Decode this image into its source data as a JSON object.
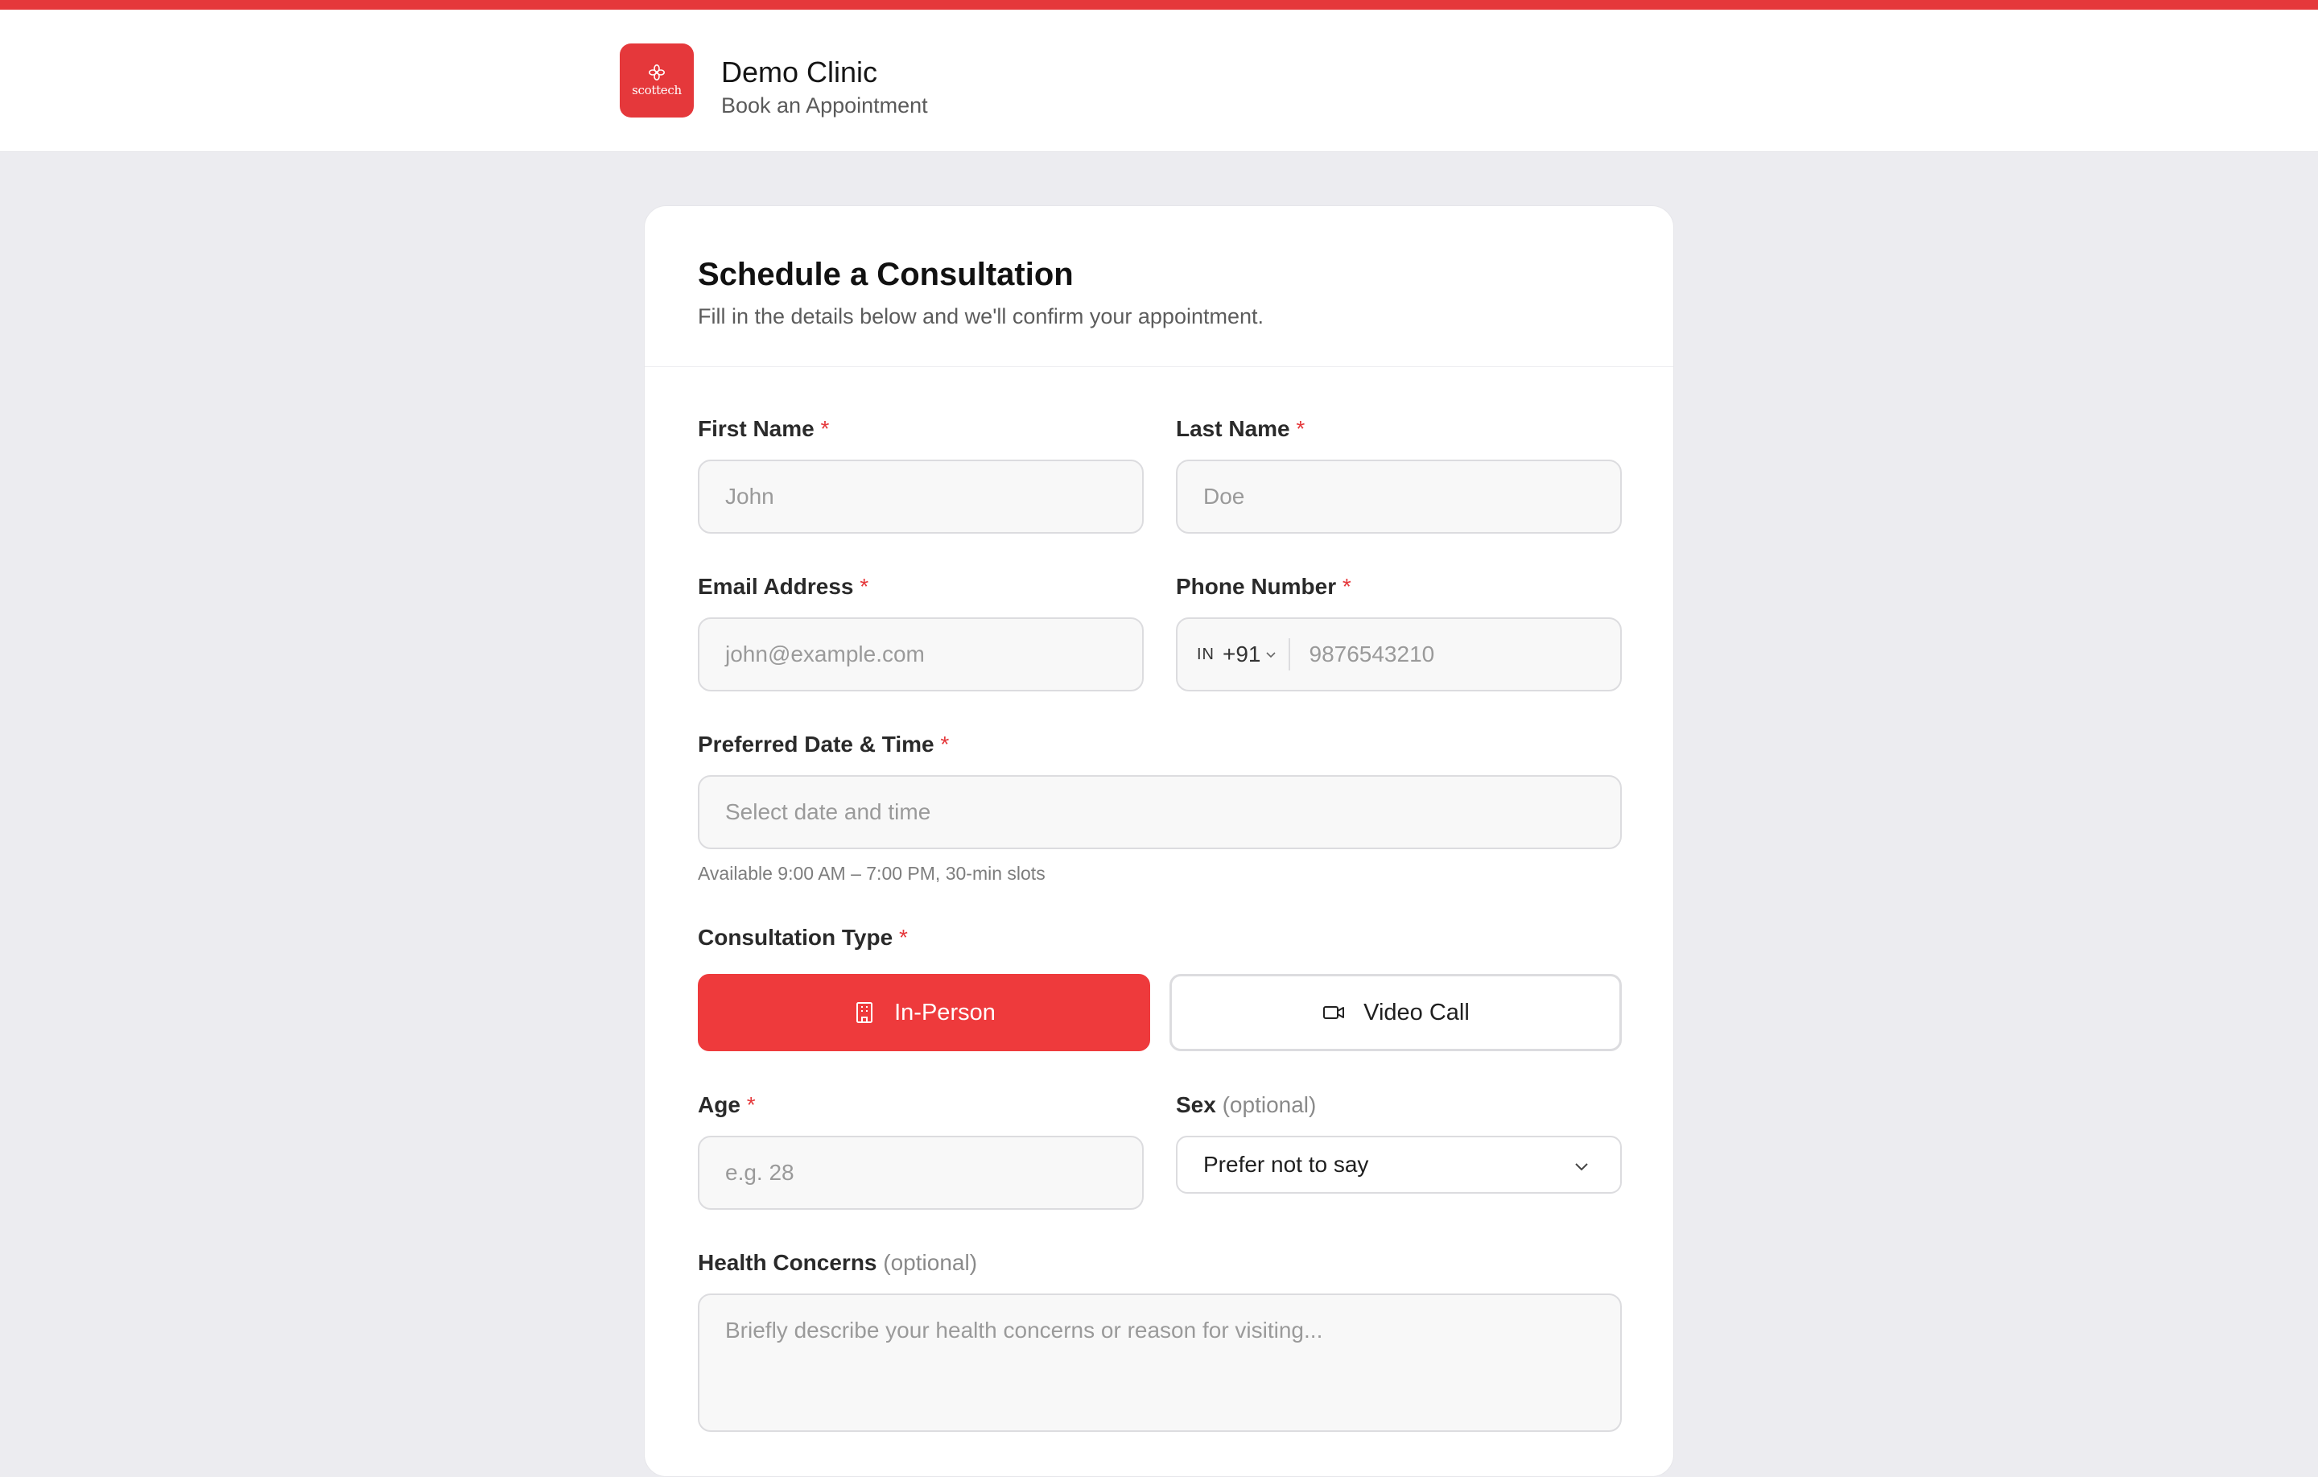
{
  "colors": {
    "accent": "#e5383b",
    "page_bg": "#ececf0"
  },
  "header": {
    "logo_text": "scottech",
    "clinic_name": "Demo Clinic",
    "subtitle": "Book an Appointment"
  },
  "form": {
    "title": "Schedule a Consultation",
    "description": "Fill in the details below and we'll confirm your appointment.",
    "required_marker": "*",
    "first_name": {
      "label": "First Name",
      "placeholder": "John"
    },
    "last_name": {
      "label": "Last Name",
      "placeholder": "Doe"
    },
    "email": {
      "label": "Email Address",
      "placeholder": "john@example.com"
    },
    "phone": {
      "label": "Phone Number",
      "country_code": "IN",
      "dial_code": "+91",
      "placeholder": "9876543210"
    },
    "datetime": {
      "label": "Preferred Date & Time",
      "placeholder": "Select date and time",
      "hint": "Available 9:00 AM – 7:00 PM, 30-min slots"
    },
    "consultation_type": {
      "label": "Consultation Type",
      "options": [
        {
          "label": "In-Person",
          "icon": "building-icon",
          "selected": true
        },
        {
          "label": "Video Call",
          "icon": "video-camera-icon",
          "selected": false
        }
      ]
    },
    "age": {
      "label": "Age",
      "placeholder": "e.g. 28"
    },
    "sex": {
      "label": "Sex",
      "optional_text": "(optional)",
      "value": "Prefer not to say"
    },
    "health_concerns": {
      "label": "Health Concerns",
      "optional_text": "(optional)",
      "placeholder": "Briefly describe your health concerns or reason for visiting..."
    }
  }
}
